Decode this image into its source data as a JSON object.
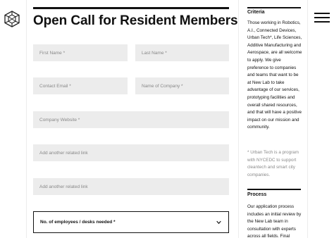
{
  "brand": {
    "logo_icon": "hexagon-cube-logo-icon"
  },
  "nav": {
    "menu_icon": "hamburger-menu-icon"
  },
  "form": {
    "title": "Open Call for Resident Members",
    "first_name_placeholder": "First Name *",
    "last_name_placeholder": "Last Name *",
    "contact_email_placeholder": "Contact Email *",
    "company_name_placeholder": "Name of Company *",
    "company_website_placeholder": "Company Website *",
    "related_link_1_placeholder": "Add another related link",
    "related_link_2_placeholder": "Add another related link",
    "employees_select_label": "No. of employees / desks needed *",
    "employees_select_icon": "chevron-down-icon"
  },
  "sidebar": {
    "criteria_heading": "Criteria",
    "criteria_text": "Those working in Robotics, A.I., Connected Devices, Urban Tech*, Life Sciences, Additive Manufacturing and Aerospace, are all welcome to apply. We give preference to companies and teams that want to be at New Lab to take advantage of our services, prototyping facilities and overall shared resources, and that will have a positive impact on our mission and community.",
    "urban_tech_note": "* Urban Tech is a program with NYCEDC to support cleantech and smart city companies.",
    "process_heading": "Process",
    "process_text": "Our application process includes an initial review by the New Lab team in consultation with experts across all fields. Final"
  }
}
